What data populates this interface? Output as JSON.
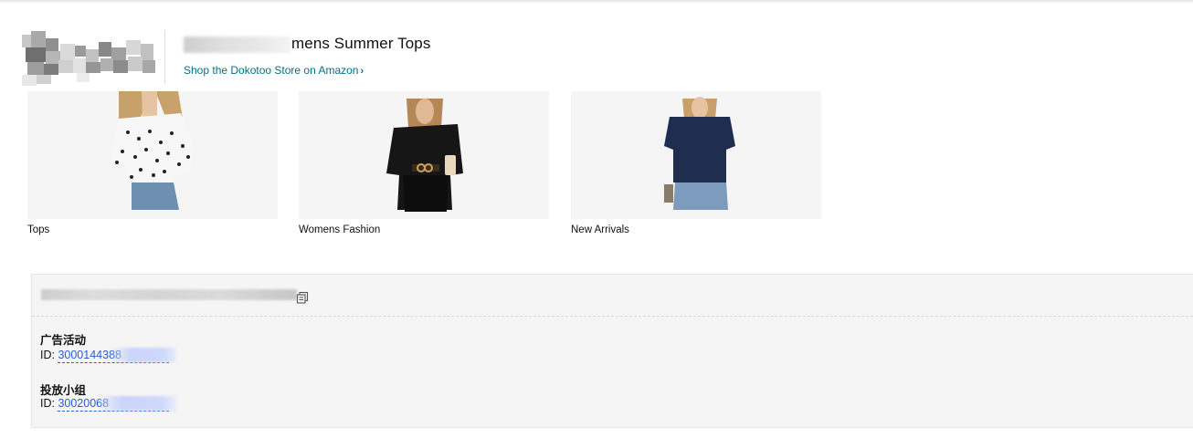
{
  "brand": {
    "logo_icon": "brand-logo (pixelated / redacted)",
    "headline": "mens Summer Tops",
    "store_link_label": "Shop the Dokotoo Store on Amazon",
    "store_link_chevron": "›"
  },
  "tiles": [
    {
      "caption": "Tops",
      "image_icon": "woman-polka-dot-blouse-image"
    },
    {
      "caption": "Womens Fashion",
      "image_icon": "woman-black-top-image"
    },
    {
      "caption": "New Arrivals",
      "image_icon": "woman-navy-top-image"
    }
  ],
  "panel": {
    "copy_icon": "copy-icon",
    "campaign": {
      "label": "广告活动",
      "id_prefix": "ID: ",
      "id_value": "3000144388"
    },
    "ad_group": {
      "label": "投放小组",
      "id_prefix": "ID: ",
      "id_value": "30020068"
    }
  },
  "colors": {
    "link": "#007185",
    "id_link": "#2b5cd6",
    "panel_bg": "#f5f5f5",
    "tile_bg": "#f5f5f5"
  }
}
